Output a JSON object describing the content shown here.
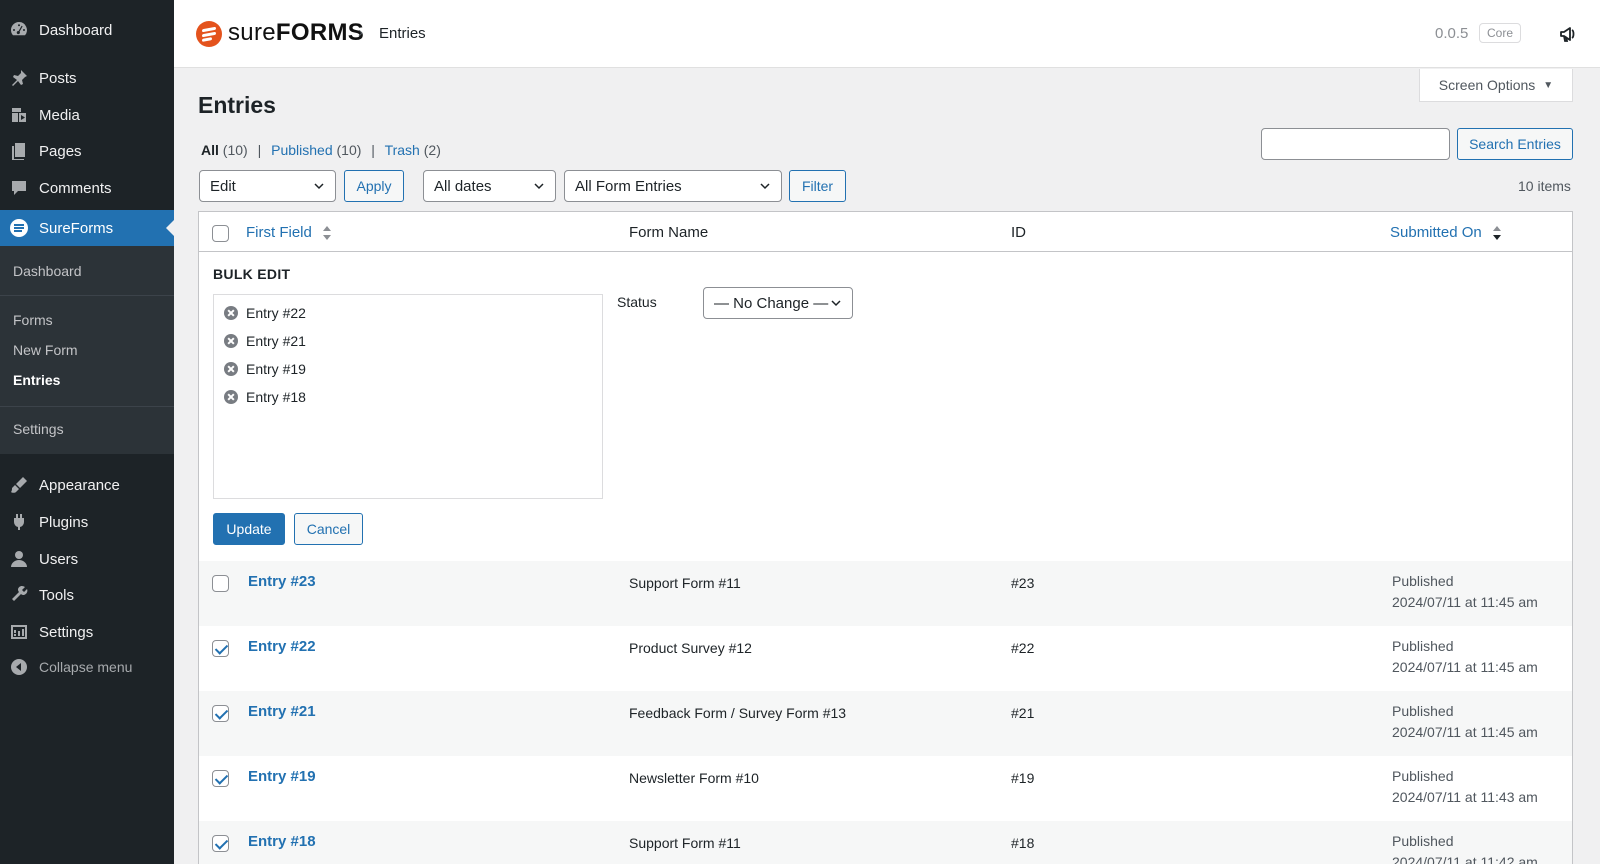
{
  "sidebar": {
    "items": [
      {
        "label": "Dashboard",
        "icon": "dashboard-icon"
      },
      {
        "label": "Posts",
        "icon": "pushpin-icon"
      },
      {
        "label": "Media",
        "icon": "media-icon"
      },
      {
        "label": "Pages",
        "icon": "pages-icon"
      },
      {
        "label": "Comments",
        "icon": "comment-icon"
      },
      {
        "label": "SureForms",
        "icon": "sureforms-icon"
      },
      {
        "label": "Appearance",
        "icon": "brush-icon"
      },
      {
        "label": "Plugins",
        "icon": "plugin-icon"
      },
      {
        "label": "Users",
        "icon": "user-icon"
      },
      {
        "label": "Tools",
        "icon": "wrench-icon"
      },
      {
        "label": "Settings",
        "icon": "settings-icon"
      }
    ],
    "submenu": {
      "dashboard": "Dashboard",
      "forms": "Forms",
      "new_form": "New Form",
      "entries": "Entries",
      "settings": "Settings"
    },
    "collapse": "Collapse menu"
  },
  "header": {
    "logo_part1": "sure",
    "logo_part2": "FORMS",
    "breadcrumb_sep": "›",
    "breadcrumb": "Entries",
    "version": "0.0.5",
    "badge": "Core"
  },
  "screen_options": "Screen Options",
  "page_title": "Entries",
  "views": {
    "all_label": "All",
    "all_count": "(10)",
    "published_label": "Published",
    "published_count": "(10)",
    "trash_label": "Trash",
    "trash_count": "(2)",
    "sep": "|"
  },
  "search_button": "Search Entries",
  "bulk_action": "Edit",
  "apply": "Apply",
  "date_filter": "All dates",
  "form_filter": "All Form Entries",
  "filter_button": "Filter",
  "items_count": "10 items",
  "table": {
    "columns": {
      "first_field": "First Field",
      "form_name": "Form Name",
      "id": "ID",
      "submitted_on": "Submitted On"
    },
    "bulk_edit": {
      "title": "BULK EDIT",
      "entries": [
        "Entry #22",
        "Entry #21",
        "Entry #19",
        "Entry #18"
      ],
      "status_label": "Status",
      "status_value": "— No Change —",
      "update": "Update",
      "cancel": "Cancel"
    },
    "rows": [
      {
        "title": "Entry #23",
        "form": "Support Form #11",
        "id": "#23",
        "status": "Published",
        "date": "2024/07/11 at 11:45 am",
        "checked": false
      },
      {
        "title": "Entry #22",
        "form": "Product Survey #12",
        "id": "#22",
        "status": "Published",
        "date": "2024/07/11 at 11:45 am",
        "checked": true
      },
      {
        "title": "Entry #21",
        "form": "Feedback Form / Survey Form #13",
        "id": "#21",
        "status": "Published",
        "date": "2024/07/11 at 11:45 am",
        "checked": true
      },
      {
        "title": "Entry #19",
        "form": "Newsletter Form #10",
        "id": "#19",
        "status": "Published",
        "date": "2024/07/11 at 11:43 am",
        "checked": true
      },
      {
        "title": "Entry #18",
        "form": "Support Form #11",
        "id": "#18",
        "status": "Published",
        "date": "2024/07/11 at 11:42 am",
        "checked": true
      }
    ]
  },
  "colors": {
    "sidebar_bg": "#1d2327",
    "accent": "#2271b1",
    "brand": "#e4531d"
  }
}
